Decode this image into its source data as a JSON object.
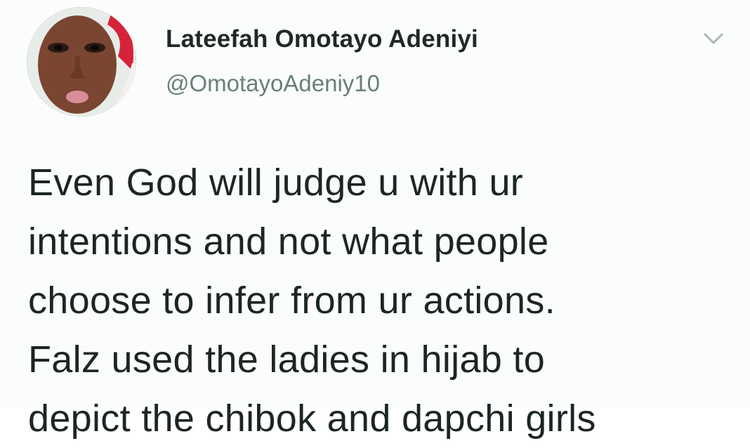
{
  "author": {
    "display_name": "Lateefah Omotayo Adeniyi",
    "handle": "@OmotayoAdeniy10"
  },
  "tweet": {
    "lines": [
      "Even God will judge u with ur",
      "intentions and not what people",
      "choose to infer from ur actions.",
      "Falz used the ladies in hijab to",
      "depict the chibok and dapchi girls"
    ]
  },
  "icons": {
    "menu": "chevron-down-icon"
  },
  "colors": {
    "name": "#1f2a25",
    "handle": "#69807a",
    "text": "#1c2622",
    "caret": "#a9b8b3"
  }
}
